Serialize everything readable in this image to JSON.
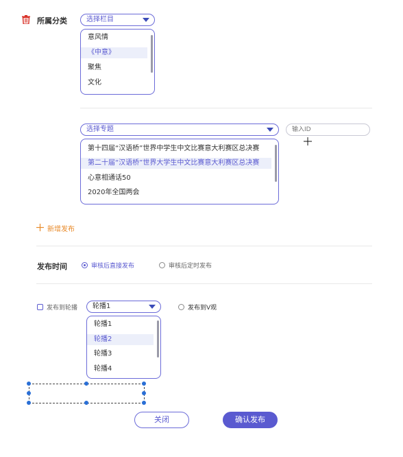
{
  "category": {
    "label": "所属分类",
    "select_placeholder": "选择栏目",
    "options": [
      "意风情",
      "《中意》",
      "聚焦",
      "文化"
    ],
    "selected_index": 1
  },
  "topic": {
    "select_placeholder": "选择专题",
    "id_placeholder": "输入ID",
    "options": [
      "第十四届“汉语桥”世界中学生中文比赛意大利赛区总决赛",
      "第二十届“汉语桥”世界大学生中文比赛意大利赛区总决赛",
      "心意相通话50",
      "2020年全国两会"
    ],
    "selected_index": 1
  },
  "add_publish": {
    "icon": "plus-icon",
    "label": "新增发布"
  },
  "publish_time": {
    "label": "发布时间",
    "option_immediate": "审核后直接发布",
    "option_scheduled": "审核后定时发布",
    "selected": "immediate"
  },
  "carousel": {
    "checkbox_label": "发布到轮播",
    "checked": false,
    "selected_value": "轮播1",
    "options": [
      "轮播1",
      "轮播2",
      "轮播3",
      "轮播4"
    ],
    "highlighted_index": 1,
    "v_label": "发布到V观"
  },
  "actions": {
    "close_label": "关闭",
    "confirm_label": "确认发布"
  },
  "colors": {
    "accent": "#5a5ad0",
    "delete_icon": "#d9342b",
    "add": "#e88a2a",
    "handle": "#2a6fd6"
  }
}
